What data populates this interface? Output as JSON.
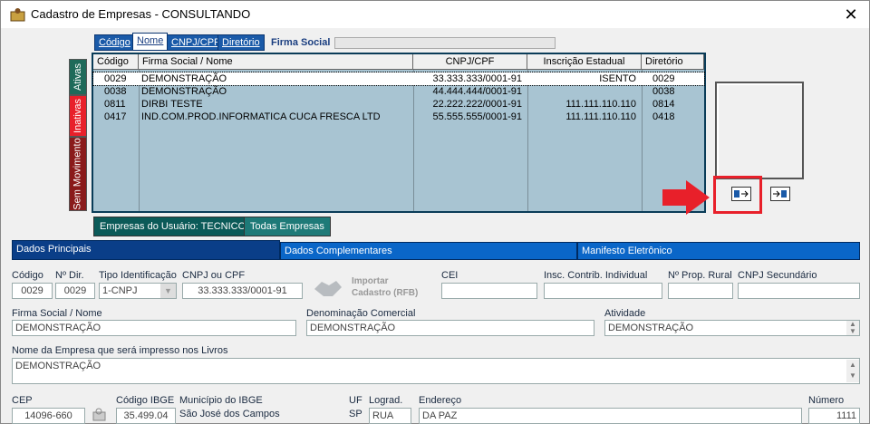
{
  "window": {
    "title": "Cadastro de Empresas  -  CONSULTANDO",
    "close_glyph": "✕"
  },
  "search_tabs": [
    {
      "label": "Código"
    },
    {
      "label": "Nome"
    },
    {
      "label": "CNPJ/CPF"
    },
    {
      "label": "Diretório"
    }
  ],
  "search": {
    "label": "Firma Social",
    "value": ""
  },
  "side_tabs": {
    "ativas": "Ativas",
    "inativas": "Inativas",
    "sem_movimento": "Sem Movimento"
  },
  "grid": {
    "headers": [
      "Código",
      "Firma Social / Nome",
      "CNPJ/CPF",
      "Inscrição Estadual",
      "Diretório"
    ],
    "rows": [
      [
        "0029",
        "DEMONSTRAÇÃO",
        "33.333.333/0001-91",
        "ISENTO",
        "0029"
      ],
      [
        "0038",
        "DEMONSTRAÇÃO",
        "44.444.444/0001-91",
        "",
        "0038"
      ],
      [
        "0811",
        "DIRBI TESTE",
        "22.222.222/0001-91",
        "111.111.110.110",
        "0814"
      ],
      [
        "0417",
        "IND.COM.PROD.INFORMATICA CUCA FRESCA LTD",
        "55.555.555/0001-91",
        "111.111.110.110",
        "0418"
      ]
    ]
  },
  "bottom_tabs": {
    "usuario": "Empresas do Usuário: TECNICO",
    "todas": "Todas Empresas"
  },
  "section_tabs": [
    "Dados Principais",
    "Dados Complementares",
    "Manifesto Eletrônico"
  ],
  "form": {
    "codigo": {
      "label": "Código",
      "value": "0029"
    },
    "nro_dir": {
      "label": "Nº Dir.",
      "value": "0029"
    },
    "tipo_id": {
      "label": "Tipo Identificação",
      "value": "1-CNPJ"
    },
    "cnpj": {
      "label": "CNPJ ou CPF",
      "value": "33.333.333/0001-91"
    },
    "importar": {
      "line1": "Importar",
      "line2": "Cadastro (RFB)"
    },
    "cei": {
      "label": "CEI",
      "value": ""
    },
    "insc_ind": {
      "label": "Insc. Contrib. Individual",
      "value": ""
    },
    "prop_rural": {
      "label": "Nº Prop. Rural",
      "value": ""
    },
    "cnpj_sec": {
      "label": "CNPJ Secundário",
      "value": ""
    },
    "firma": {
      "label": "Firma Social / Nome",
      "value": "DEMONSTRAÇÃO"
    },
    "denominacao": {
      "label": "Denominação Comercial",
      "value": "DEMONSTRAÇÃO"
    },
    "atividade": {
      "label": "Atividade",
      "value": "DEMONSTRAÇÃO"
    },
    "nome_livros": {
      "label": "Nome da Empresa que será impresso nos Livros",
      "value": "DEMONSTRAÇÃO"
    },
    "cep": {
      "label": "CEP",
      "value": "14096-660"
    },
    "ibge": {
      "label": "Código IBGE",
      "value": "35.499.04"
    },
    "municipio": {
      "label": "Município do IBGE",
      "value": "São José dos Campos"
    },
    "uf": {
      "label": "UF",
      "value": "SP"
    },
    "lograd": {
      "label": "Lograd.",
      "value": "RUA"
    },
    "endereco": {
      "label": "Endereço",
      "value": "DA PAZ"
    },
    "numero": {
      "label": "Número",
      "value": "1111"
    }
  },
  "colors": {
    "accent": "#1a5aa8",
    "highlight": "#e8202a",
    "grid_bg": "#a8c4d2"
  }
}
